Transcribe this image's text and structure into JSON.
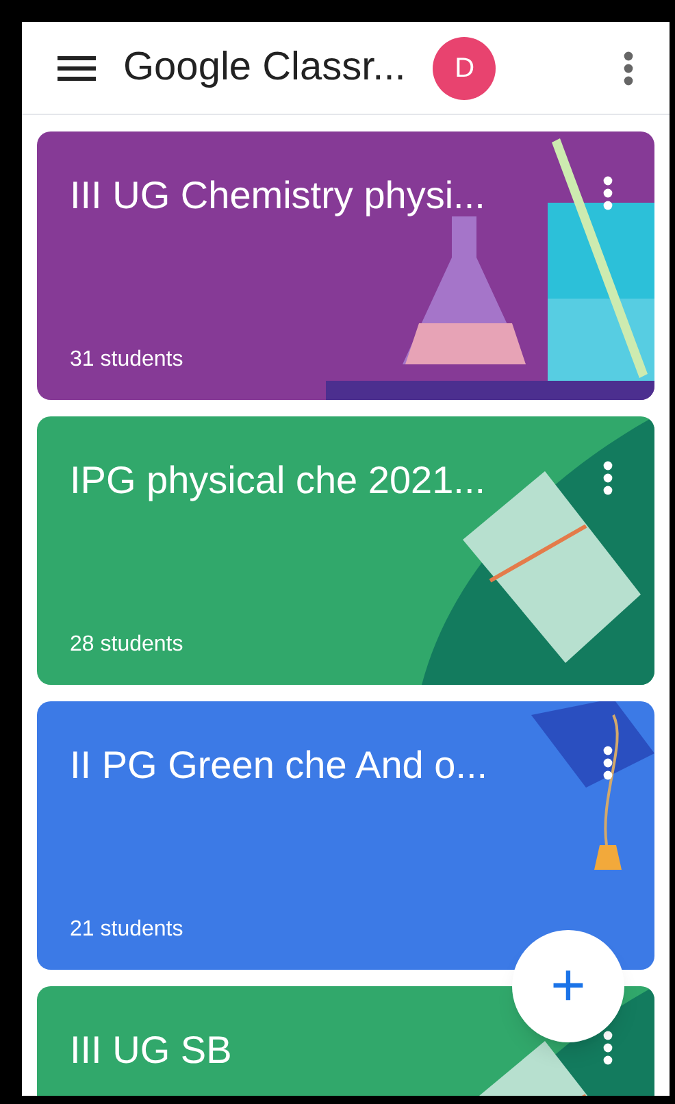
{
  "app_bar": {
    "title": "Google Classr...",
    "avatar": "D"
  },
  "classes": [
    {
      "title": "III UG Chemistry physi...",
      "students": "31 students",
      "color": "#863a96",
      "kind": "science"
    },
    {
      "title": "IPG physical che 2021...",
      "students": "28 students",
      "color": "#31a86b",
      "kind": "books"
    },
    {
      "title": "II PG Green che And o...",
      "students": "21 students",
      "color": "#3c7ae6",
      "kind": "graduation"
    },
    {
      "title": "III UG SB",
      "color": "#31a86b",
      "kind": "books"
    }
  ],
  "fab": {
    "label": "+"
  }
}
